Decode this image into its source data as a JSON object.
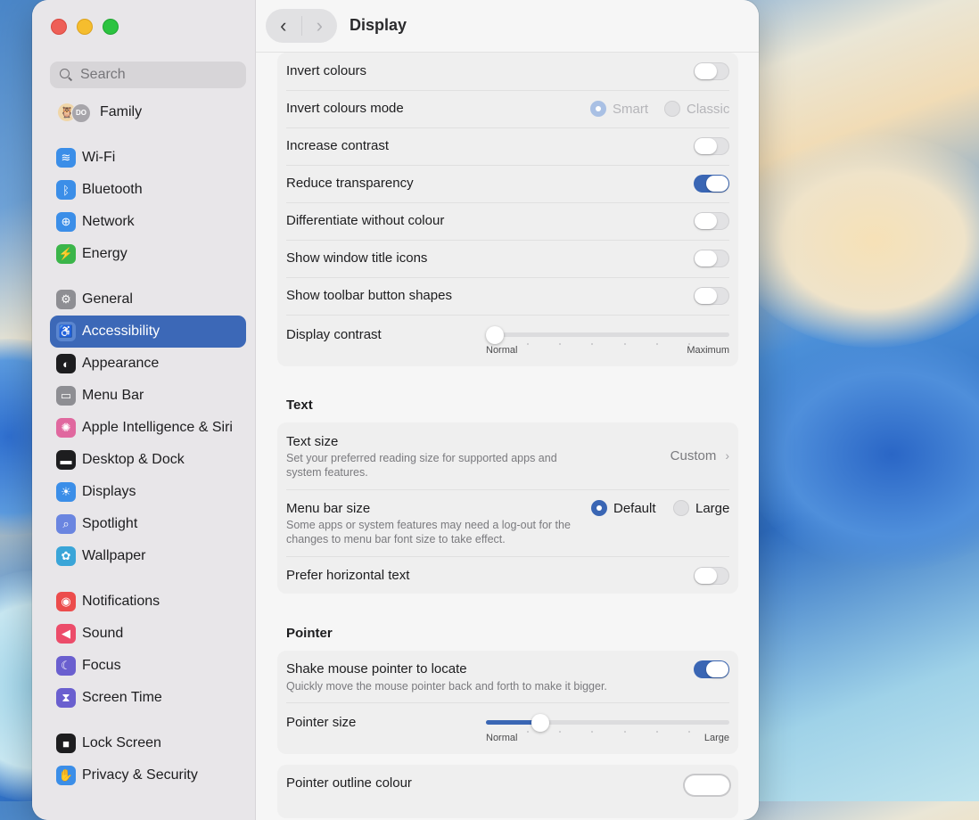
{
  "window": {
    "title": "Display"
  },
  "sidebar": {
    "search_placeholder": "Search",
    "family": {
      "label": "Family",
      "avatar_initials": "DO"
    },
    "items": [
      {
        "label": "Wi-Fi",
        "icon": "wifi-icon",
        "color": "#3b8ee8",
        "active": false
      },
      {
        "label": "Bluetooth",
        "icon": "bluetooth-icon",
        "color": "#3b8ee8",
        "active": false
      },
      {
        "label": "Network",
        "icon": "globe-icon",
        "color": "#3b8ee8",
        "active": false
      },
      {
        "label": "Energy",
        "icon": "bolt-icon",
        "color": "#3bb54a",
        "active": false
      },
      {
        "label": "General",
        "icon": "gear-icon",
        "color": "#8e8e93",
        "active": false
      },
      {
        "label": "Accessibility",
        "icon": "accessibility-icon",
        "color": "#3b8ee8",
        "active": true
      },
      {
        "label": "Appearance",
        "icon": "appearance-icon",
        "color": "#1d1d1f",
        "active": false
      },
      {
        "label": "Menu Bar",
        "icon": "menubar-icon",
        "color": "#8e8e93",
        "active": false
      },
      {
        "label": "Apple Intelligence & Siri",
        "icon": "siri-icon",
        "color": "#e0689f",
        "active": false
      },
      {
        "label": "Desktop & Dock",
        "icon": "dock-icon",
        "color": "#1d1d1f",
        "active": false
      },
      {
        "label": "Displays",
        "icon": "sun-icon",
        "color": "#3b8ee8",
        "active": false
      },
      {
        "label": "Spotlight",
        "icon": "spotlight-icon",
        "color": "#6a85e0",
        "active": false
      },
      {
        "label": "Wallpaper",
        "icon": "flower-icon",
        "color": "#3aa5d8",
        "active": false
      },
      {
        "label": "Notifications",
        "icon": "bell-icon",
        "color": "#ec4c4c",
        "active": false
      },
      {
        "label": "Sound",
        "icon": "speaker-icon",
        "color": "#ec4c6a",
        "active": false
      },
      {
        "label": "Focus",
        "icon": "moon-icon",
        "color": "#6a5fcf",
        "active": false
      },
      {
        "label": "Screen Time",
        "icon": "hourglass-icon",
        "color": "#6a5fcf",
        "active": false
      },
      {
        "label": "Lock Screen",
        "icon": "lock-icon",
        "color": "#1d1d1f",
        "active": false
      },
      {
        "label": "Privacy & Security",
        "icon": "hand-icon",
        "color": "#3b8ee8",
        "active": false
      }
    ]
  },
  "display_card": {
    "rows": [
      {
        "label": "Invert colours",
        "type": "toggle",
        "on": false
      },
      {
        "label": "Invert colours mode",
        "type": "radio",
        "options": [
          "Smart",
          "Classic"
        ],
        "selected": "Smart",
        "disabled": true
      },
      {
        "label": "Increase contrast",
        "type": "toggle",
        "on": false
      },
      {
        "label": "Reduce transparency",
        "type": "toggle",
        "on": true
      },
      {
        "label": "Differentiate without colour",
        "type": "toggle",
        "on": false
      },
      {
        "label": "Show window title icons",
        "type": "toggle",
        "on": false
      },
      {
        "label": "Show toolbar button shapes",
        "type": "toggle",
        "on": false
      }
    ],
    "display_contrast": {
      "label": "Display contrast",
      "min_label": "Normal",
      "max_label": "Maximum",
      "value": 0.0
    }
  },
  "text_section": {
    "heading": "Text",
    "text_size": {
      "label": "Text size",
      "description": "Set your preferred reading size for supported apps and system features.",
      "value": "Custom"
    },
    "menu_bar_size": {
      "label": "Menu bar size",
      "description": "Some apps or system features may need a log-out for the changes to menu bar font size to take effect.",
      "options": [
        "Default",
        "Large"
      ],
      "selected": "Default"
    },
    "prefer_horizontal": {
      "label": "Prefer horizontal text",
      "on": false
    }
  },
  "pointer_section": {
    "heading": "Pointer",
    "shake": {
      "label": "Shake mouse pointer to locate",
      "description": "Quickly move the mouse pointer back and forth to make it bigger.",
      "on": true
    },
    "pointer_size": {
      "label": "Pointer size",
      "min_label": "Normal",
      "max_label": "Large",
      "value": 0.2
    },
    "outline_colour": {
      "label": "Pointer outline colour",
      "color": "#ffffff"
    }
  }
}
